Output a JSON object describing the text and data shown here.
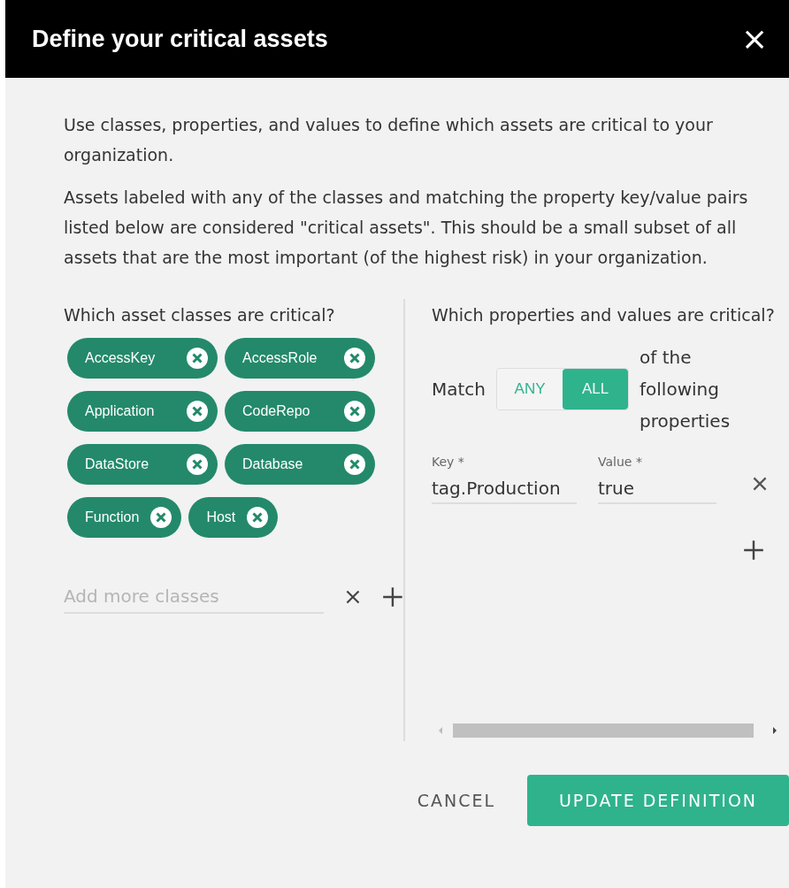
{
  "dialog": {
    "title": "Define your critical assets",
    "close": "×"
  },
  "intro": [
    "Use classes, properties, and values to define which assets are critical to your organization.",
    "Assets labeled with any of the classes and matching the property key/value pairs listed below are considered \"critical assets\". This should be a small subset of all assets that are the most important (of the highest risk) in your organization."
  ],
  "classes": {
    "heading": "Which asset classes are critical?",
    "chips": [
      {
        "label": "AccessKey"
      },
      {
        "label": "AccessRole"
      },
      {
        "label": "Application"
      },
      {
        "label": "CodeRepo"
      },
      {
        "label": "DataStore"
      },
      {
        "label": "Database"
      },
      {
        "label": "Function"
      },
      {
        "label": "Host"
      }
    ],
    "add_field": {
      "placeholder": "Add more classes"
    }
  },
  "properties": {
    "heading": "Which properties and values are critical?",
    "match_label": "Match",
    "match_options": [
      {
        "label": "ANY",
        "selected": false
      },
      {
        "label": "ALL",
        "selected": true
      }
    ],
    "match_suffix": "of the following properties",
    "rows": [
      {
        "key_label": "Key *",
        "key": "tag.Production",
        "value_label": "Value *",
        "value": "true"
      }
    ]
  },
  "buttons": {
    "cancel": "CANCEL",
    "submit": "UPDATE DEFINITION"
  }
}
